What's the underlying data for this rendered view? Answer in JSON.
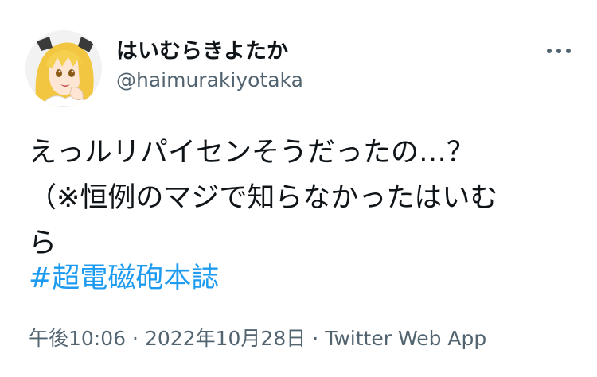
{
  "author": {
    "display_name": "はいむらきよたか",
    "handle": "@haimurakiyotaka",
    "avatar_icon": "avatar-anime-character"
  },
  "tweet": {
    "text_lines": [
      "えっルリパイセンそうだったの…？",
      "（※恒例のマジで知らなかったはいむ",
      "ら"
    ],
    "hashtag": "#超電磁砲本誌"
  },
  "meta": {
    "time": "午後10:06",
    "separator": "·",
    "date": "2022年10月28日",
    "source": "Twitter Web App"
  },
  "colors": {
    "link": "#1d9bf0",
    "secondary_text": "#536471",
    "primary_text": "#0f1419"
  },
  "icons": {
    "more": "more-horizontal-icon"
  }
}
